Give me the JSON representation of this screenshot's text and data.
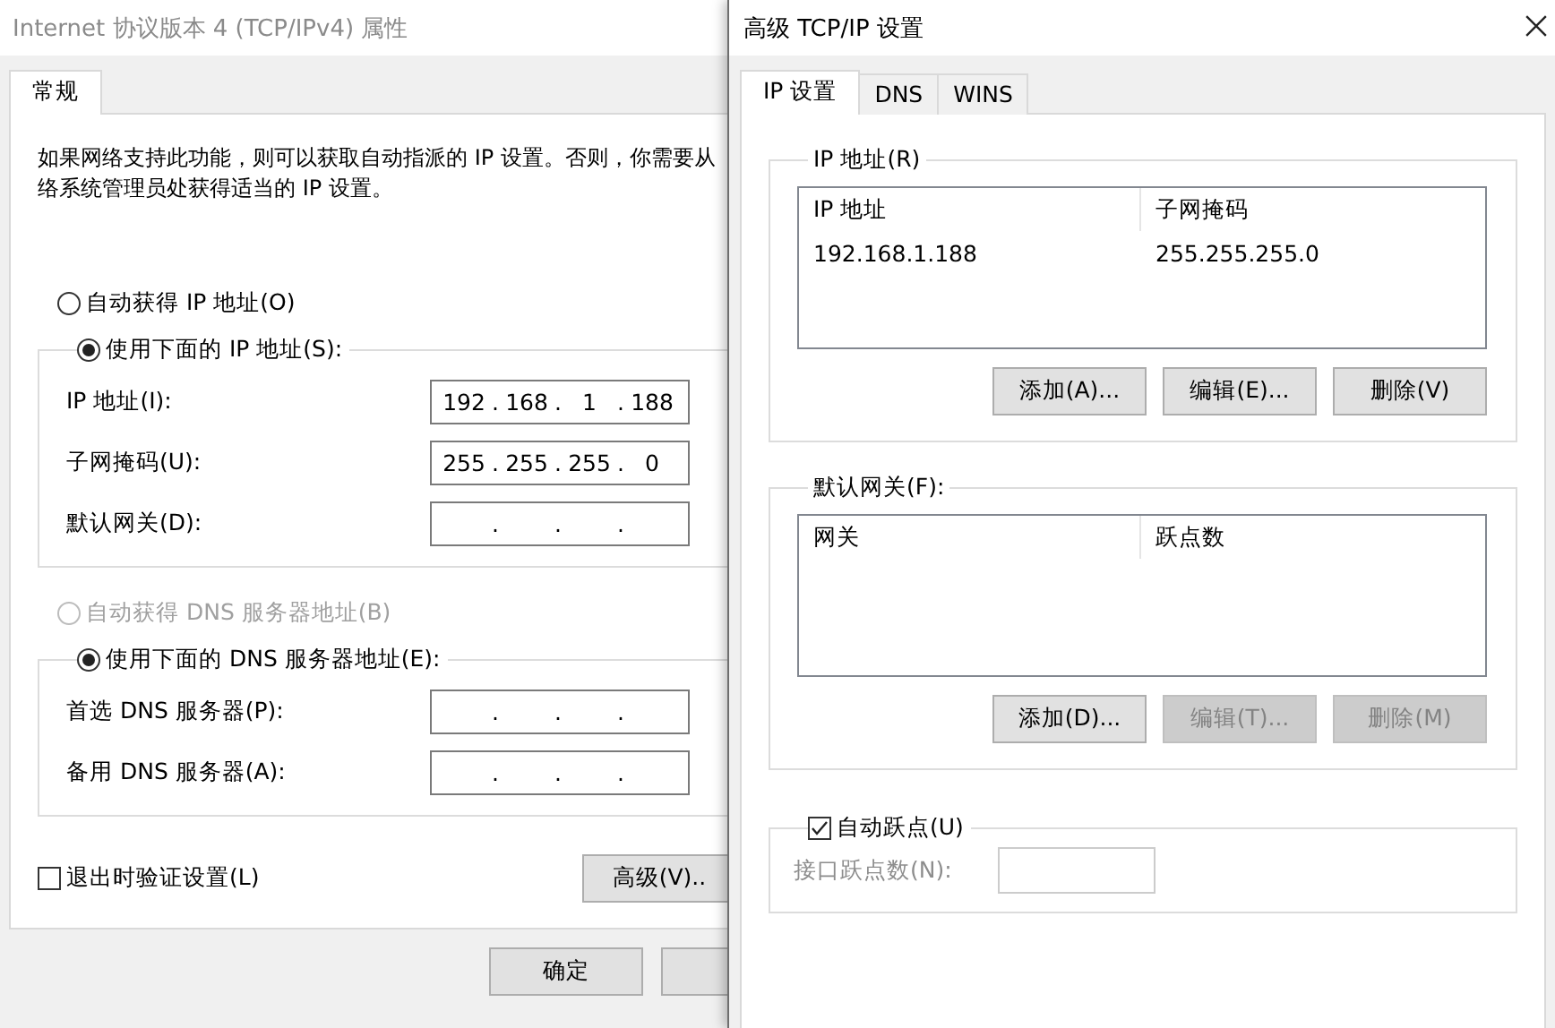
{
  "main_window": {
    "title": "Internet 协议版本 4 (TCP/IPv4) 属性",
    "tabs": [
      {
        "label": "常规",
        "selected": true
      }
    ],
    "description": [
      "如果网络支持此功能，则可以获取自动指派的 IP 设置。否则，你需要从",
      "络系统管理员处获得适当的 IP 设置。"
    ],
    "ip_mode": [
      {
        "label": "自动获得 IP 地址(O)",
        "selected": false,
        "disabled": false
      },
      {
        "label": "使用下面的 IP 地址(S):",
        "selected": true,
        "disabled": false,
        "fields": [
          {
            "label": "IP 地址(I):",
            "octets": [
              "192",
              "168",
              "1",
              "188"
            ],
            "dots": [
              ".",
              ".",
              "."
            ]
          },
          {
            "label": "子网掩码(U):",
            "octets": [
              "255",
              "255",
              "255",
              "0"
            ],
            "dots": [
              ".",
              ".",
              "."
            ]
          },
          {
            "label": "默认网关(D):",
            "dots": [
              ".",
              ".",
              "."
            ]
          }
        ]
      }
    ],
    "dns_mode": [
      {
        "label": "自动获得 DNS 服务器地址(B)",
        "selected": false,
        "disabled": true
      },
      {
        "label": "使用下面的 DNS 服务器地址(E):",
        "selected": true,
        "disabled": false,
        "fields": [
          {
            "label": "首选 DNS 服务器(P):",
            "dots": [
              ".",
              ".",
              "."
            ]
          },
          {
            "label": "备用 DNS 服务器(A):",
            "dots": [
              ".",
              ".",
              "."
            ]
          }
        ]
      }
    ],
    "validate": {
      "label": "退出时验证设置(L)",
      "checked": false
    },
    "advanced_button": "高级(V)..",
    "buttons": [
      {
        "label": "确定"
      },
      {
        "kind": "cut"
      }
    ]
  },
  "advanced_window": {
    "title": "高级 TCP/IP 设置",
    "tabs": [
      {
        "label": "IP 设置",
        "selected": true
      },
      {
        "label": "DNS",
        "selected": false
      },
      {
        "label": "WINS",
        "selected": false
      }
    ],
    "ip_group": {
      "title": "IP 地址(R)",
      "columns": [
        "IP 地址",
        "子网掩码"
      ],
      "rows": [
        [
          "192.168.1.188",
          "255.255.255.0"
        ]
      ],
      "buttons": [
        {
          "label": "添加(A)...",
          "disabled": false
        },
        {
          "label": "编辑(E)...",
          "disabled": false
        },
        {
          "label": "删除(V)",
          "disabled": false
        }
      ]
    },
    "gateway_group": {
      "title": "默认网关(F):",
      "columns": [
        "网关",
        "跃点数"
      ],
      "buttons": [
        {
          "label": "添加(D)...",
          "disabled": false
        },
        {
          "label": "编辑(T)...",
          "disabled": true
        },
        {
          "label": "删除(M)",
          "disabled": true
        }
      ]
    },
    "auto_metric": {
      "label": "自动跃点(U)",
      "checked": true
    },
    "metric_field": {
      "label": "接口跃点数(N):",
      "disabled": true
    }
  }
}
